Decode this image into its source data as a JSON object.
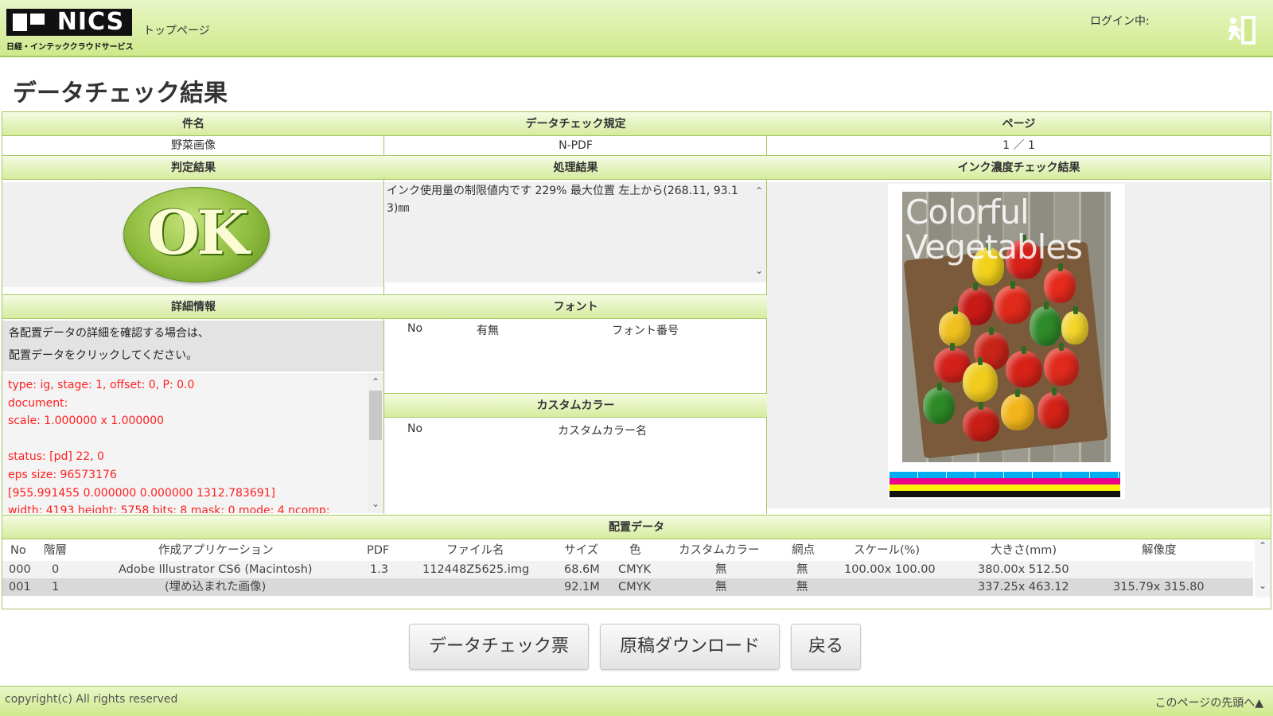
{
  "header": {
    "logo_text": "NICS",
    "logo_subtitle": "日経・インテッククラウドサービス",
    "top_link": "トップページ",
    "login_status": "ログイン中:",
    "logout_icon": "exit-door-icon"
  },
  "page_title": "データチェック結果",
  "summary": {
    "subject_header": "件名",
    "subject_value": "野菜画像",
    "rule_header": "データチェック規定",
    "rule_value": "N-PDF",
    "page_header": "ページ",
    "page_value": "1 ／ 1"
  },
  "judgment": {
    "header": "判定結果",
    "result": "OK"
  },
  "processing": {
    "header": "処理結果",
    "text": "インク使用量の制限値内です 229% 最大位置 左上から(268.11, 93.13)㎜"
  },
  "ink_check": {
    "header": "インク濃度チェック結果",
    "preview_title_line1": "Colorful",
    "preview_title_line2": "Vegetables"
  },
  "details": {
    "header": "詳細情報",
    "note_line1": "各配置データの詳細を確認する場合は、",
    "note_line2": "配置データをクリックしてください。",
    "log": [
      "type: ig, stage: 1, offset: 0, P: 0.0",
      "document:",
      "scale: 1.000000 x 1.000000",
      "",
      "status: [pd] 22, 0",
      "eps size: 96573176",
      "[955.991455 0.000000 0.000000 1312.783691]",
      "width: 4193 height: 5758 bits: 8 mask: 0 mode: 4 ncomp:"
    ]
  },
  "fonts": {
    "header": "フォント",
    "col_no": "No",
    "col_presence": "有無",
    "col_font_number": "フォント番号"
  },
  "custom_colors": {
    "header": "カスタムカラー",
    "col_no": "No",
    "col_name": "カスタムカラー名"
  },
  "placement": {
    "header": "配置データ",
    "columns": [
      "No",
      "階層",
      "作成アプリケーション",
      "PDF",
      "ファイル名",
      "サイズ",
      "色",
      "カスタムカラー",
      "網点",
      "スケール(%)",
      "大きさ(mm)",
      "解像度"
    ],
    "rows": [
      [
        "000",
        "0",
        "Adobe Illustrator CS6 (Macintosh)",
        "1.3",
        "112448Z5625.img",
        "68.6M",
        "CMYK",
        "無",
        "無",
        "100.00x 100.00",
        "380.00x 512.50",
        ""
      ],
      [
        "001",
        "1",
        "(埋め込まれた画像)",
        "",
        "",
        "92.1M",
        "CMYK",
        "無",
        "無",
        "",
        "337.25x 463.12",
        "315.79x 315.80"
      ]
    ]
  },
  "buttons": {
    "check_sheet": "データチェック票",
    "download": "原稿ダウンロード",
    "back": "戻る"
  },
  "footer": {
    "copyright": "copyright(c) All rights reserved",
    "to_top": "このページの先頭へ▲"
  },
  "colors": {
    "header_green": "#cfe98c",
    "border_green": "#a7c763",
    "log_red": "#ff2020",
    "ok_green": "#8fbd3e"
  }
}
